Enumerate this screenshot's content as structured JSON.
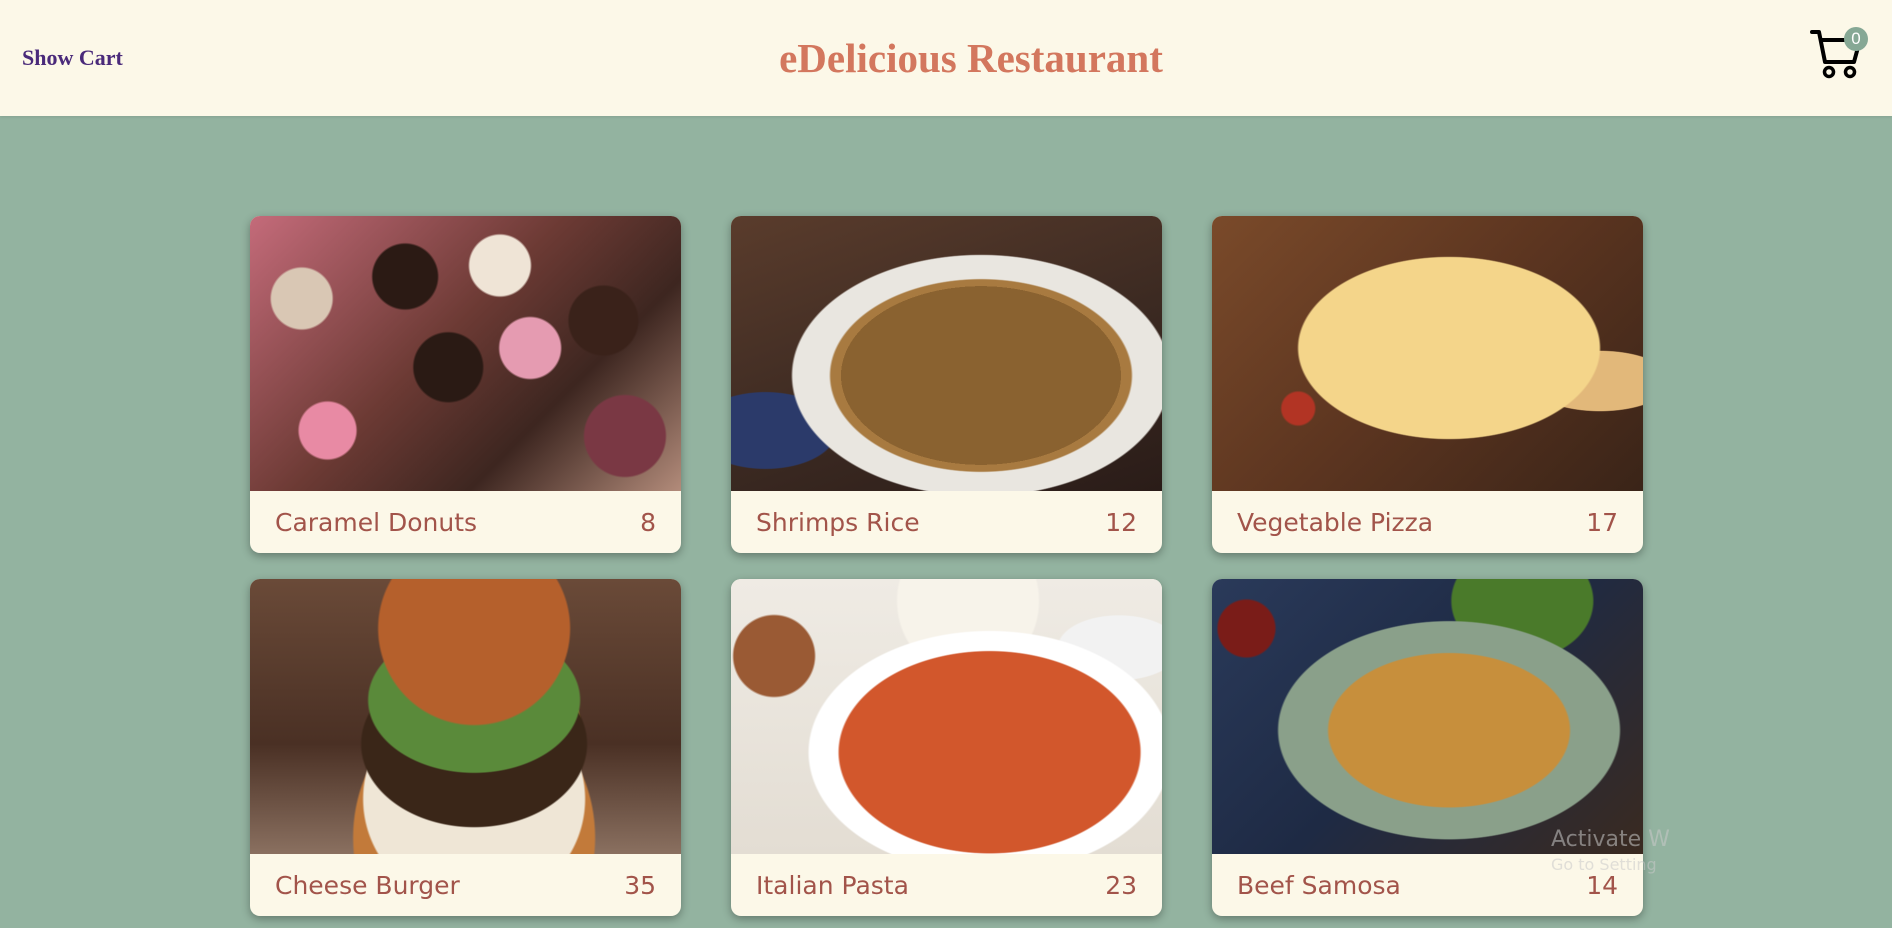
{
  "header": {
    "show_cart_label": "Show Cart",
    "title": "eDelicious Restaurant",
    "cart_count": "0",
    "cart_icon": "shopping-cart-icon"
  },
  "colors": {
    "page_background": "#93b3a0",
    "header_background": "#fcf8e8",
    "title_color": "#d3775e",
    "show_cart_color": "#4a2a7a",
    "card_text_color": "#a2544a",
    "badge_color": "#86a895"
  },
  "menu": {
    "items": [
      {
        "name": "Caramel Donuts",
        "price": "8",
        "image": "donuts-image"
      },
      {
        "name": "Shrimps Rice",
        "price": "12",
        "image": "rice-image"
      },
      {
        "name": "Vegetable Pizza",
        "price": "17",
        "image": "pizza-image"
      },
      {
        "name": "Cheese Burger",
        "price": "35",
        "image": "burger-image"
      },
      {
        "name": "Italian Pasta",
        "price": "23",
        "image": "pasta-image"
      },
      {
        "name": "Beef Samosa",
        "price": "14",
        "image": "samosa-image"
      }
    ]
  },
  "watermark": {
    "line1": "Activate W",
    "line2": "Go to Setting"
  }
}
